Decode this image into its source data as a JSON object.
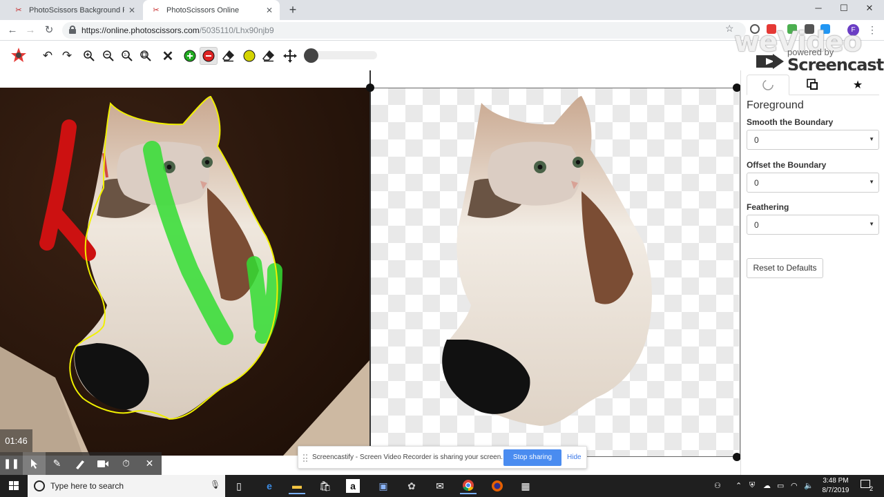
{
  "browser": {
    "tabs": [
      {
        "title": "PhotoScissors Background Remo",
        "active": false
      },
      {
        "title": "PhotoScissors Online",
        "active": true
      }
    ],
    "url_host": "https://online.photoscissors.com",
    "url_path": "/5035110/Lhx90njb9",
    "profile_initial": "F"
  },
  "watermark": {
    "brand": "weVideo",
    "powered_by": "powered by",
    "product": "Screencastify"
  },
  "toolbar": {
    "tools": [
      "undo-icon",
      "redo-icon",
      "zoom-in-icon",
      "zoom-out-icon",
      "zoom-actual-icon",
      "zoom-fit-icon",
      "clear-icon",
      "foreground-marker-icon",
      "background-marker-icon",
      "eraser-icon",
      "hair-marker-icon",
      "hair-eraser-icon",
      "pan-icon"
    ],
    "selected_tool": "background-marker-icon",
    "brush_size": 0
  },
  "panel": {
    "tabs": [
      "foreground-tab",
      "background-tab",
      "effects-tab"
    ],
    "active_tab": "foreground-tab",
    "title": "Foreground",
    "smooth_label": "Smooth the Boundary",
    "smooth_value": "0",
    "offset_label": "Offset the Boundary",
    "offset_value": "0",
    "feathering_label": "Feathering",
    "feathering_value": "0",
    "reset_label": "Reset to Defaults"
  },
  "recorder": {
    "timer": "01:46"
  },
  "sharebar": {
    "message": "Screencastify - Screen Video Recorder is sharing your screen.",
    "stop_label": "Stop sharing",
    "hide_label": "Hide"
  },
  "taskbar": {
    "search_placeholder": "Type here to search",
    "time": "3:48 PM",
    "date": "8/7/2019",
    "notifications": "2"
  },
  "colors": {
    "accent_blue": "#4a8cf0",
    "foreground_marker": "#33cc33",
    "background_marker": "#cc1111",
    "selection_outline": "#f0f000"
  }
}
